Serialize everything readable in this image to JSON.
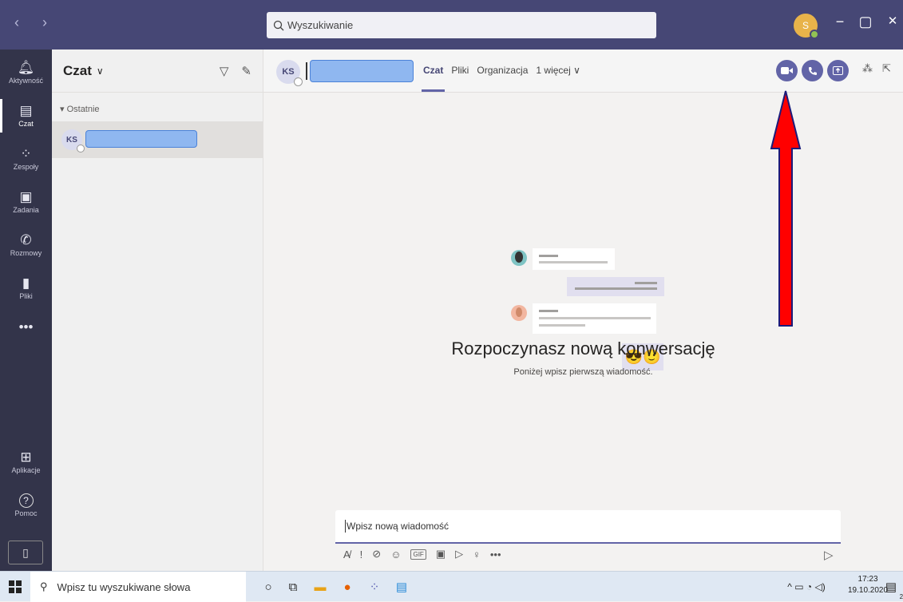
{
  "titlebar": {
    "nav": "‹ ›",
    "search_placeholder": "Wyszukiwanie",
    "user_initial": "S",
    "minimize": "−",
    "maximize": "▢",
    "close": "✕"
  },
  "rail": {
    "items": [
      {
        "label": "Aktywność",
        "glyph": "🔔"
      },
      {
        "label": "Czat",
        "glyph": "▤"
      },
      {
        "label": "Zespoły",
        "glyph": "⁘"
      },
      {
        "label": "Zadania",
        "glyph": "🔒"
      },
      {
        "label": "Rozmowy",
        "glyph": "✆"
      },
      {
        "label": "Pliki",
        "glyph": "▮"
      },
      {
        "label": "",
        "glyph": "•••"
      }
    ],
    "apps": {
      "label": "Aplikacje",
      "glyph": "⊞"
    },
    "help": {
      "label": "Pomoc",
      "glyph": "?"
    },
    "device_glyph": "▯"
  },
  "chatlist": {
    "title": "Czat",
    "caret": "∨",
    "filter_icon": "▽",
    "compose_icon": "✎",
    "section": "Ostatnie",
    "items": [
      {
        "initials": "KS"
      }
    ]
  },
  "header": {
    "initials": "KS",
    "tabs": [
      "Czat",
      "Pliki",
      "Organizacja",
      "1 więcej ∨"
    ],
    "extra_icon_1": "⁂",
    "extra_icon_2": "⇱"
  },
  "empty_state": {
    "title": "Rozpoczynasz nową konwersację",
    "subtitle": "Poniżej wpisz pierwszą wiadomość.",
    "emoji": "😎🙂"
  },
  "composer": {
    "placeholder": "Wpisz nową wiadomość",
    "tools": [
      "A̸",
      "!",
      "⊘",
      "☺",
      "GIF",
      "▣",
      "▷",
      "♀",
      "•••"
    ],
    "send": "▷"
  },
  "taskbar": {
    "search_text": "Wpisz tu wyszukiwane słowa",
    "time": "17:23",
    "date": "19.10.2020",
    "notif": "2"
  },
  "colors": {
    "titlebar": "#464775",
    "rail": "#33344a",
    "accent": "#6264a7",
    "annotation_arrow": "#ff0000"
  }
}
